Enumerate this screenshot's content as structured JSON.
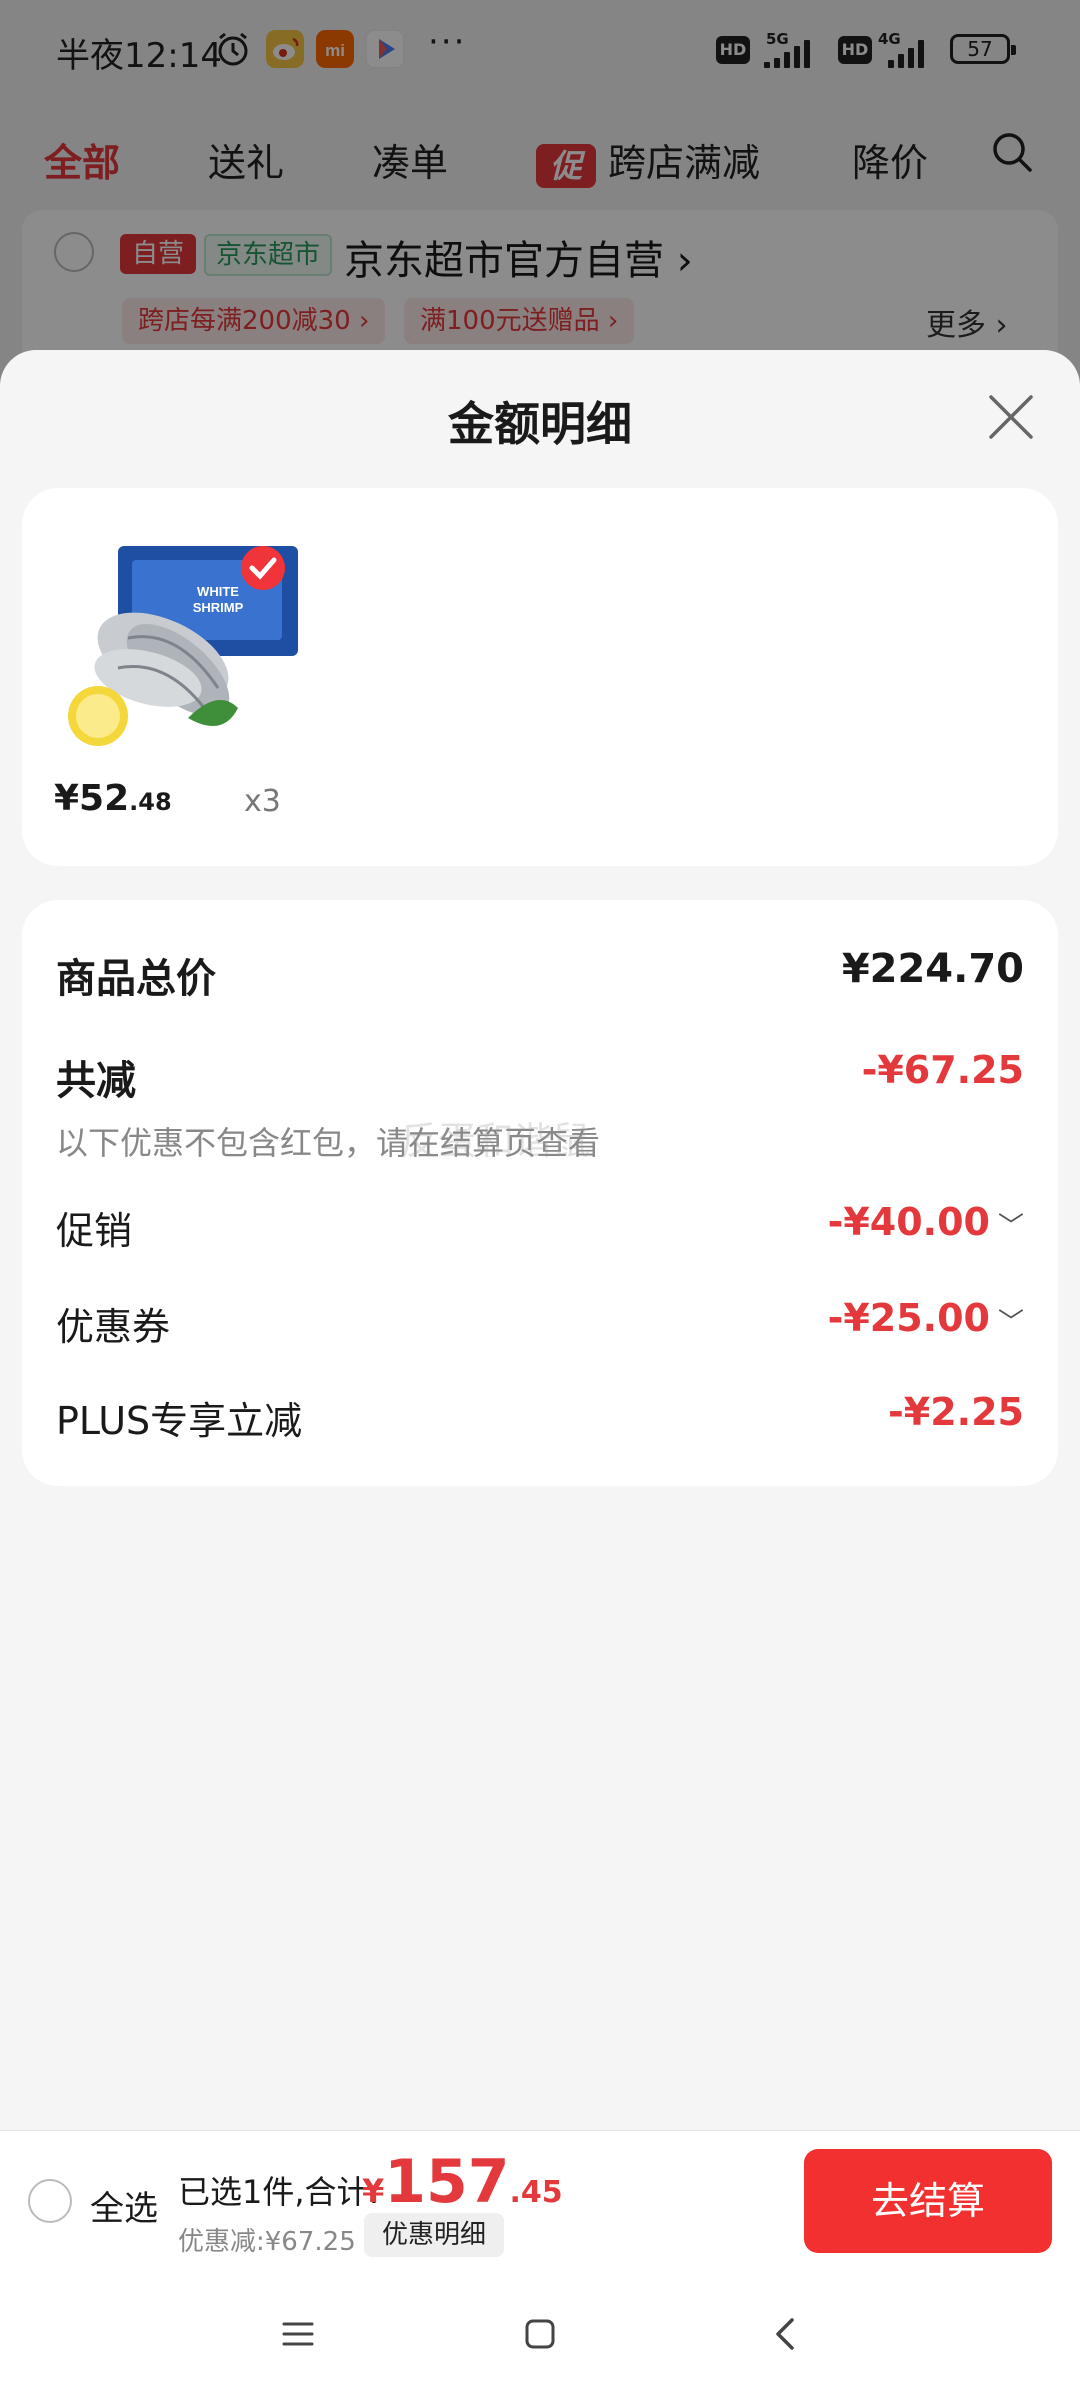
{
  "status_bar": {
    "time": "半夜12:14",
    "more": "···",
    "net1": "5G",
    "net2": "4G",
    "hd": "HD",
    "battery": "57"
  },
  "tabs": {
    "items": [
      "全部",
      "送礼",
      "凑单",
      "跨店满减",
      "降价"
    ],
    "promo_badge": "促",
    "active_index": 0
  },
  "store": {
    "self_badge": "自营",
    "jd_badge": "京东超市",
    "name": "京东超市官方自营 ›",
    "coupon1": "跨店每满200减30 ›",
    "coupon2": "满100元送赠品 ›",
    "more": "更多 ›"
  },
  "sheet": {
    "title": "金额明细"
  },
  "product": {
    "price_int": "¥52",
    "price_dec": ".48",
    "quantity": "x3"
  },
  "details": {
    "total_label": "商品总价",
    "total_value": "¥224.70",
    "reduce_label": "共减",
    "reduce_value": "-¥67.25",
    "note": "以下优惠不包含红包，请在结算页查看",
    "promo_label": "促销",
    "promo_value": "-¥40.00",
    "coupon_label": "优惠券",
    "coupon_value": "-¥25.00",
    "plus_label": "PLUS专享立减",
    "plus_value": "-¥2.25",
    "chevron": "﹀"
  },
  "bottom": {
    "select_all": "全选",
    "selected_text": "已选1件,合计:",
    "currency": "¥",
    "total_int": "157",
    "total_dec": ".45",
    "saving": "优惠减:¥67.25",
    "detail_chip": "优惠明细",
    "checkout": "去结算"
  },
  "watermark": "反蛋和谐鼠",
  "colors": {
    "accent": "#e4393c",
    "checkout": "#f23030",
    "jd_green": "#2b9a5b"
  }
}
